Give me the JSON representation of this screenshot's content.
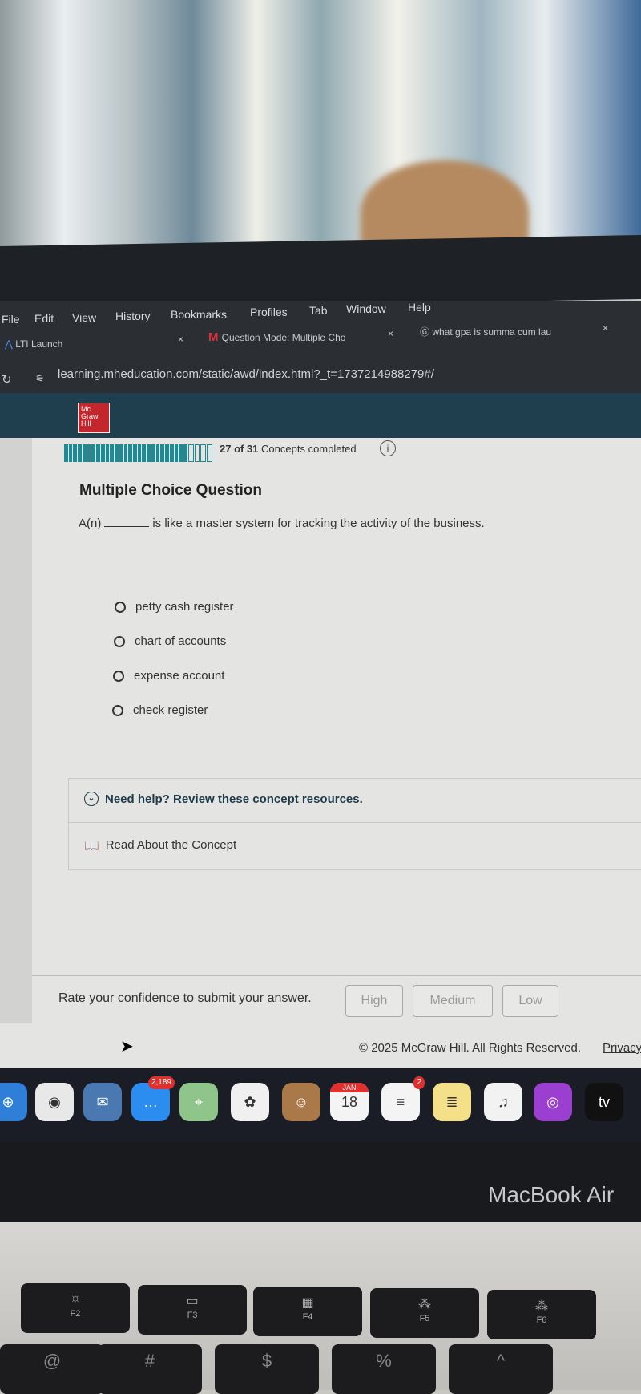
{
  "menu_bar": [
    "File",
    "Edit",
    "View",
    "History",
    "Bookmarks",
    "Profiles",
    "Tab",
    "Window",
    "Help"
  ],
  "tabs": [
    {
      "label": "LTI Launch",
      "icon": "lti-icon"
    },
    {
      "label": "Question Mode: Multiple Cho",
      "icon": "mcgraw-m-icon"
    },
    {
      "label": "what gpa is summa cum lau",
      "icon": "google-icon"
    }
  ],
  "tab_close": "×",
  "url": "learning.mheducation.com/static/awd/index.html?_t=1737214988279#/",
  "logo": "Mc Graw Hill",
  "progress": {
    "completed": 27,
    "total": 31,
    "text_count": "27 of 31",
    "text_label": "Concepts completed",
    "info": "i"
  },
  "question": {
    "title": "Multiple Choice Question",
    "prefix": "A(n)",
    "suffix": "is like a master system for tracking the activity of the business.",
    "options": [
      "petty cash register",
      "chart of accounts",
      "expense account",
      "check register"
    ]
  },
  "help": {
    "title": "Need help? Review these concept resources.",
    "read": "Read About the Concept"
  },
  "confidence": {
    "prompt": "Rate your confidence to submit your answer.",
    "buttons": [
      "High",
      "Medium",
      "Low"
    ]
  },
  "footer": {
    "copyright": "© 2025 McGraw Hill. All Rights Reserved.",
    "privacy": "Privacy"
  },
  "dock": [
    {
      "name": "safari",
      "glyph": "⊕",
      "color": "#2f7fd8"
    },
    {
      "name": "chrome",
      "glyph": "◉",
      "color": "#e8e8e8"
    },
    {
      "name": "mail",
      "glyph": "✉",
      "color": "#4a78b0"
    },
    {
      "name": "messages",
      "glyph": "…",
      "color": "#2b8df0",
      "badge": "2,189"
    },
    {
      "name": "maps",
      "glyph": "⌖",
      "color": "#8fc48a"
    },
    {
      "name": "photos",
      "glyph": "✿",
      "color": "#f0f0f0"
    },
    {
      "name": "contacts",
      "glyph": "☺",
      "color": "#a9794a"
    },
    {
      "name": "calendar",
      "glyph": "18",
      "color": "#f4f4f4",
      "month": "JAN"
    },
    {
      "name": "reminders",
      "glyph": "≡",
      "color": "#f4f4f4",
      "badge": "2"
    },
    {
      "name": "notes",
      "glyph": "≣",
      "color": "#f5e08a"
    },
    {
      "name": "music",
      "glyph": "♫",
      "color": "#f2f2f2"
    },
    {
      "name": "podcasts",
      "glyph": "◎",
      "color": "#9b3fd0"
    },
    {
      "name": "tv",
      "glyph": "tv",
      "color": "#111"
    }
  ],
  "laptop_label": "MacBook Air",
  "keys": [
    {
      "label": "F2",
      "icon": "☼"
    },
    {
      "label": "F3",
      "icon": "▭"
    },
    {
      "label": "F4",
      "icon": "▦"
    },
    {
      "label": "F5",
      "icon": "⁂"
    },
    {
      "label": "F6",
      "icon": "⁂"
    }
  ],
  "number_keys": [
    "@",
    "#",
    "$",
    "%",
    "^"
  ]
}
